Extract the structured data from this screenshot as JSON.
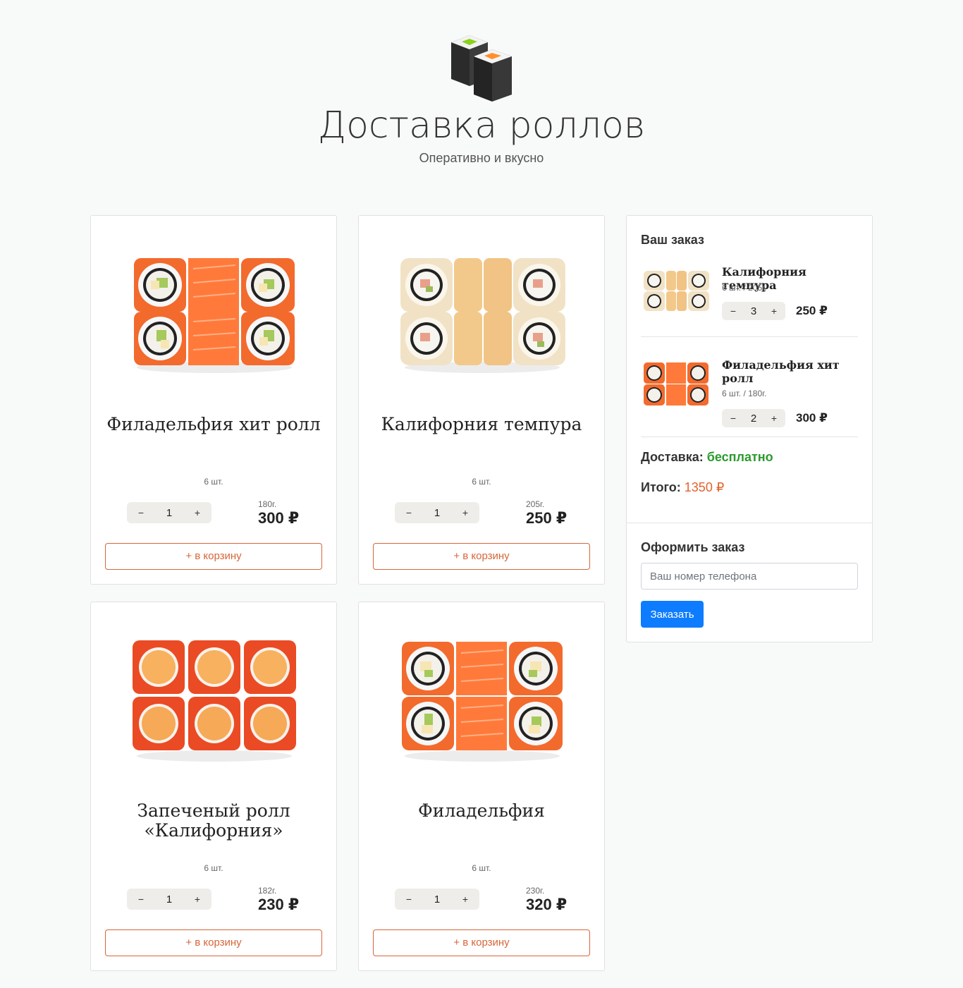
{
  "header": {
    "title": "Доставка роллов",
    "subtitle": "Оперативно и вкусно"
  },
  "products": [
    {
      "name": "Филадельфия хит ролл",
      "pcs": "6 шт.",
      "qty": "1",
      "weight": "180г.",
      "price": "300 ₽",
      "add_label": "+ в корзину",
      "minus": "−",
      "plus": "+"
    },
    {
      "name": "Калифорния темпура",
      "pcs": "6 шт.",
      "qty": "1",
      "weight": "205г.",
      "price": "250 ₽",
      "add_label": "+ в корзину",
      "minus": "−",
      "plus": "+"
    },
    {
      "name": "Запеченый ролл «Калифорния»",
      "pcs": "6 шт.",
      "qty": "1",
      "weight": "182г.",
      "price": "230 ₽",
      "add_label": "+ в корзину",
      "minus": "−",
      "plus": "+"
    },
    {
      "name": "Филадельфия",
      "pcs": "6 шт.",
      "qty": "1",
      "weight": "230г.",
      "price": "320 ₽",
      "add_label": "+ в корзину",
      "minus": "−",
      "plus": "+"
    }
  ],
  "order": {
    "title": "Ваш заказ",
    "items": [
      {
        "name": "Калифорния темпура",
        "meta": "6 шт. / 205г.",
        "qty": "3",
        "price": "250 ₽",
        "minus": "−",
        "plus": "+"
      },
      {
        "name": "Филадельфия хит ролл",
        "meta": "6 шт. / 180г.",
        "qty": "2",
        "price": "300 ₽",
        "minus": "−",
        "plus": "+"
      }
    ],
    "delivery_label": "Доставка:",
    "delivery_value": "бесплатно",
    "total_label": "Итого:",
    "total_value": "1350 ₽",
    "checkout_title": "Оформить заказ",
    "phone_placeholder": "Ваш номер телефона",
    "submit_label": "Заказать"
  },
  "colors": {
    "accent": "#d7663a",
    "free": "#2b9a2e",
    "total": "#e2632d",
    "button": "#0d7cff"
  }
}
